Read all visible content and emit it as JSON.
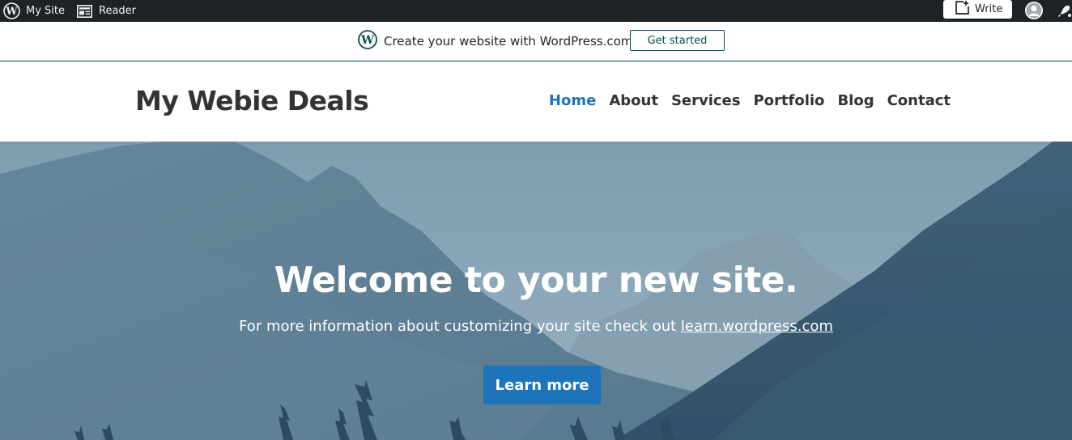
{
  "admin_bar": {
    "my_site_label": "My Site",
    "reader_label": "Reader",
    "write_label": "Write",
    "icons": [
      "wordpress-logo-icon",
      "reader-icon",
      "write-icon",
      "avatar",
      "notifications-bell-icon"
    ]
  },
  "promo": {
    "text": "Create your website with WordPress.com",
    "button_label": "Get started"
  },
  "site": {
    "title": "My Webie Deals",
    "nav": [
      {
        "label": "Home",
        "active": true
      },
      {
        "label": "About",
        "active": false
      },
      {
        "label": "Services",
        "active": false
      },
      {
        "label": "Portfolio",
        "active": false
      },
      {
        "label": "Blog",
        "active": false
      },
      {
        "label": "Contact",
        "active": false
      }
    ]
  },
  "hero": {
    "title": "Welcome to your new site.",
    "subtitle_prefix": "For more information about customizing your site check out ",
    "subtitle_link": "learn.wordpress.com",
    "button_label": "Learn more"
  },
  "colors": {
    "admin_bar_bg": "#1d2327",
    "accent": "#1e74bb",
    "promo_border": "#0a4b4e"
  }
}
